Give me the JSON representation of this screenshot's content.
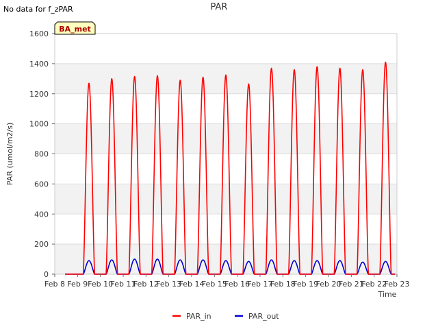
{
  "nodata_text": "No data for f_zPAR",
  "chart_data": {
    "type": "line",
    "title": "PAR",
    "xlabel": "Time",
    "ylabel": "PAR (umol/m2/s)",
    "ylim": [
      0,
      1600
    ],
    "yticks": [
      0,
      200,
      400,
      600,
      800,
      1000,
      1200,
      1400,
      1600
    ],
    "xlim": [
      "Feb 8",
      "Feb 23"
    ],
    "xticks": [
      "Feb 8",
      "Feb 9",
      "Feb 10",
      "Feb 11",
      "Feb 12",
      "Feb 13",
      "Feb 14",
      "Feb 15",
      "Feb 16",
      "Feb 17",
      "Feb 18",
      "Feb 19",
      "Feb 20",
      "Feb 21",
      "Feb 22",
      "Feb 23"
    ],
    "grid": true,
    "legend_position": "bottom-center",
    "annotation": "BA_met",
    "series": [
      {
        "name": "PAR_in",
        "color": "#ff0000",
        "daily_peaks": [
          {
            "date": "Feb 9",
            "peak": 1270
          },
          {
            "date": "Feb 10",
            "peak": 1300
          },
          {
            "date": "Feb 11",
            "peak": 1315
          },
          {
            "date": "Feb 12",
            "peak": 1320
          },
          {
            "date": "Feb 13",
            "peak": 1290
          },
          {
            "date": "Feb 14",
            "peak": 1310
          },
          {
            "date": "Feb 15",
            "peak": 1325
          },
          {
            "date": "Feb 16",
            "peak": 1265
          },
          {
            "date": "Feb 17",
            "peak": 1370
          },
          {
            "date": "Feb 18",
            "peak": 1360
          },
          {
            "date": "Feb 19",
            "peak": 1380
          },
          {
            "date": "Feb 20",
            "peak": 1370
          },
          {
            "date": "Feb 21",
            "peak": 1360
          },
          {
            "date": "Feb 22",
            "peak": 1410
          }
        ]
      },
      {
        "name": "PAR_out",
        "color": "#0000cc",
        "daily_peaks": [
          {
            "date": "Feb 9",
            "peak": 90
          },
          {
            "date": "Feb 10",
            "peak": 95
          },
          {
            "date": "Feb 11",
            "peak": 100
          },
          {
            "date": "Feb 12",
            "peak": 100
          },
          {
            "date": "Feb 13",
            "peak": 95
          },
          {
            "date": "Feb 14",
            "peak": 95
          },
          {
            "date": "Feb 15",
            "peak": 90
          },
          {
            "date": "Feb 16",
            "peak": 85
          },
          {
            "date": "Feb 17",
            "peak": 95
          },
          {
            "date": "Feb 18",
            "peak": 90
          },
          {
            "date": "Feb 19",
            "peak": 90
          },
          {
            "date": "Feb 20",
            "peak": 90
          },
          {
            "date": "Feb 21",
            "peak": 80
          },
          {
            "date": "Feb 22",
            "peak": 85
          }
        ]
      }
    ]
  }
}
